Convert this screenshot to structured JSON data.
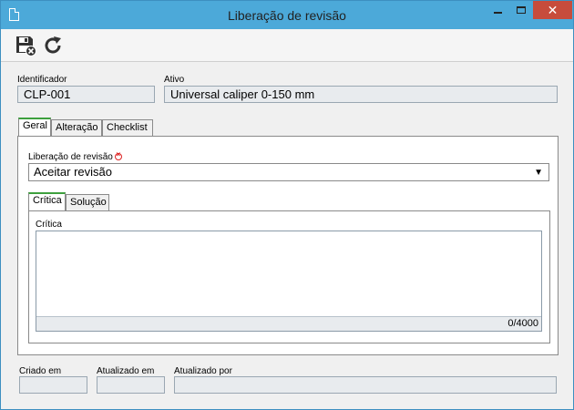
{
  "window": {
    "title": "Liberação de revisão"
  },
  "toolbar": {
    "save_icon": "save-close-icon",
    "refresh_icon": "refresh-icon"
  },
  "fields": {
    "identificador_label": "Identificador",
    "identificador_value": "CLP-001",
    "ativo_label": "Ativo",
    "ativo_value": "Universal caliper 0-150 mm"
  },
  "tabs": [
    {
      "label": "Geral",
      "active": true
    },
    {
      "label": "Alteração",
      "active": false
    },
    {
      "label": "Checklist",
      "active": false
    }
  ],
  "geral": {
    "liberacao_label": "Liberação de revisão",
    "liberacao_value": "Aceitar revisão",
    "subtabs": [
      {
        "label": "Crítica",
        "active": true
      },
      {
        "label": "Solução",
        "active": false
      }
    ],
    "critica_label": "Crítica",
    "critica_value": "",
    "critica_counter": "0/4000"
  },
  "footer": {
    "criado_em_label": "Criado em",
    "criado_em_value": "",
    "atualizado_em_label": "Atualizado em",
    "atualizado_em_value": "",
    "atualizado_por_label": "Atualizado por",
    "atualizado_por_value": ""
  },
  "colors": {
    "titlebar": "#4ca9d9",
    "close": "#c74c3c",
    "active_tab": "#3da03d"
  }
}
